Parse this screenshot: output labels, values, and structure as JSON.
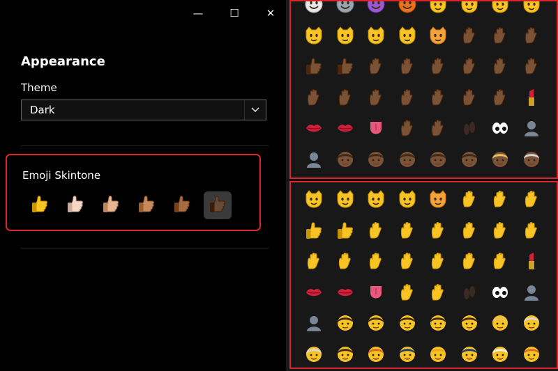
{
  "window": {
    "minimize_glyph": "—",
    "maximize_glyph": "☐",
    "close_glyph": "✕"
  },
  "settings": {
    "heading": "Appearance",
    "theme_label": "Theme",
    "theme_value": "Dark",
    "skintone_label": "Emoji Skintone",
    "skintones": [
      {
        "name": "default",
        "color": "#F7C325",
        "selected": false
      },
      {
        "name": "light",
        "color": "#F7D7C4",
        "selected": false
      },
      {
        "name": "medium-light",
        "color": "#E8B48F",
        "selected": false
      },
      {
        "name": "medium",
        "color": "#C68A5B",
        "selected": false
      },
      {
        "name": "medium-dark",
        "color": "#A66C43",
        "selected": false
      },
      {
        "name": "dark",
        "color": "#6B4A35",
        "selected": true
      }
    ]
  },
  "colors": {
    "highlight_red": "#d9262c",
    "dark_skin": "#7A5236",
    "yellow": "#F7C325"
  },
  "emoji_panel_dark": {
    "rows": [
      [
        "skull-icon",
        "alien-icon",
        "alien-monster-icon",
        "jack-o-lantern-icon",
        "grinning-cat-icon",
        "smiling-cat-icon",
        "joy-cat-icon",
        "heart-eyes-cat-icon"
      ],
      [
        "smirk-cat-icon",
        "kissing-cat-icon",
        "scream-cat-icon",
        "crying-cat-icon",
        "pouting-cat-icon",
        "open-hands-icon",
        "raised-hands-icon",
        "clapping-hands-icon"
      ],
      [
        "thumbs-up-icon",
        "thumbs-down-icon",
        "oncoming-fist-icon",
        "raised-fist-icon",
        "victory-hand-icon",
        "ok-hand-icon",
        "point-left-icon",
        "point-right-icon"
      ],
      [
        "point-up-icon",
        "point-down-icon",
        "point-up-finger-icon",
        "raised-hand-icon",
        "waving-hand-icon",
        "flexed-biceps-icon",
        "folded-hands-icon",
        "lipstick-icon"
      ],
      [
        "kiss-mark-icon",
        "mouth-icon",
        "tongue-icon",
        "ear-icon",
        "nose-icon",
        "footprints-icon",
        "eyes-icon",
        "bust-silhouette-icon"
      ],
      [
        "busts-silhouette-icon",
        "baby-icon",
        "girl-icon",
        "boy-icon",
        "woman-icon",
        "man-icon",
        "blond-person-icon",
        "older-man-icon"
      ]
    ]
  },
  "emoji_panel_default": {
    "rows": [
      [
        "smirk-cat-icon",
        "kissing-cat-icon",
        "scream-cat-icon",
        "crying-cat-icon",
        "pouting-cat-icon",
        "open-hands-icon",
        "raised-hands-icon",
        "clapping-hands-icon"
      ],
      [
        "thumbs-up-icon",
        "thumbs-down-icon",
        "oncoming-fist-icon",
        "raised-fist-icon",
        "victory-hand-icon",
        "ok-hand-icon",
        "point-left-icon",
        "point-right-icon"
      ],
      [
        "point-up-icon",
        "point-down-icon",
        "point-up-finger-icon",
        "raised-hand-icon",
        "waving-hand-icon",
        "flexed-biceps-icon",
        "folded-hands-icon",
        "lipstick-icon"
      ],
      [
        "kiss-mark-icon",
        "mouth-icon",
        "tongue-icon",
        "ear-icon",
        "nose-icon",
        "footprints-icon",
        "eyes-icon",
        "bust-silhouette-icon"
      ],
      [
        "busts-silhouette-icon",
        "baby-icon",
        "girl-icon",
        "boy-icon",
        "woman-icon",
        "man-icon",
        "blond-person-icon",
        "older-man-icon"
      ],
      [
        "older-man-icon",
        "man-with-cap-icon",
        "woman-with-headscarf-icon",
        "police-officer-icon",
        "construction-worker-icon",
        "guard-icon",
        "bride-icon",
        "red-haired-woman-icon"
      ]
    ]
  }
}
